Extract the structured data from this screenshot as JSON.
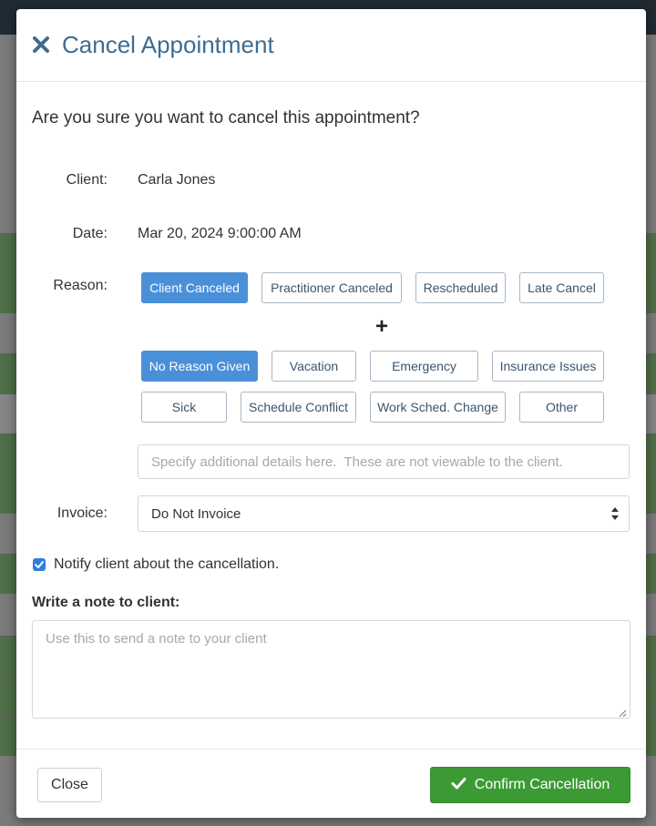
{
  "modal": {
    "title": "Cancel Appointment",
    "question": "Are you sure you want to cancel this appointment?"
  },
  "fields": {
    "client_label": "Client:",
    "client_value": "Carla Jones",
    "date_label": "Date:",
    "date_value": "Mar 20, 2024 9:00:00 AM",
    "reason_label": "Reason:",
    "invoice_label": "Invoice:"
  },
  "reasons_primary": [
    {
      "label": "Client Canceled",
      "selected": true
    },
    {
      "label": "Practitioner Canceled",
      "selected": false
    },
    {
      "label": "Rescheduled",
      "selected": false
    },
    {
      "label": "Late Cancel",
      "selected": false
    }
  ],
  "reasons_secondary": [
    {
      "label": "No Reason Given",
      "selected": true
    },
    {
      "label": "Vacation",
      "selected": false
    },
    {
      "label": "Emergency",
      "selected": false
    },
    {
      "label": "Insurance Issues",
      "selected": false
    },
    {
      "label": "Sick",
      "selected": false
    },
    {
      "label": "Schedule Conflict",
      "selected": false
    },
    {
      "label": "Work Sched. Change",
      "selected": false
    },
    {
      "label": "Other",
      "selected": false
    }
  ],
  "plus": "+",
  "details": {
    "placeholder": "Specify additional details here.  These are not viewable to the client."
  },
  "invoice": {
    "selected": "Do Not Invoice"
  },
  "notify": {
    "checked": true,
    "label": "Notify client about the cancellation."
  },
  "note": {
    "label": "Write a note to client:",
    "placeholder": "Use this to send a note to your client"
  },
  "footer": {
    "close_label": "Close",
    "confirm_label": "Confirm Cancellation"
  },
  "icons": {
    "close": "close-icon",
    "confirm": "checkmark-icon",
    "caret": "sort-caret-icon"
  },
  "colors": {
    "title": "#3d6c91",
    "selected_chip": "#4a90d9",
    "confirm_button": "#3c9a35",
    "checkbox": "#2f7de1"
  }
}
